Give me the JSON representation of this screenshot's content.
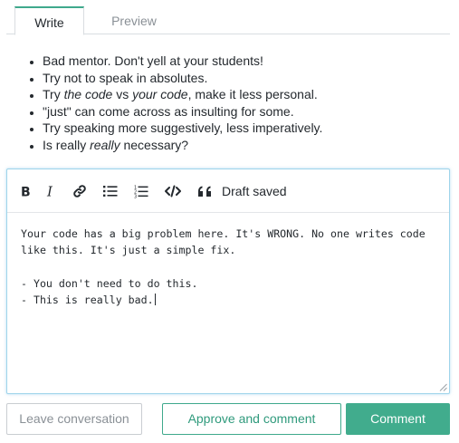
{
  "tabs": {
    "write_label": "Write",
    "preview_label": "Preview",
    "active": "Write"
  },
  "guidelines": [
    {
      "parts": [
        {
          "text": "Bad mentor. Don't yell at your students!",
          "em": false
        }
      ]
    },
    {
      "parts": [
        {
          "text": "Try not to speak in absolutes.",
          "em": false
        }
      ]
    },
    {
      "parts": [
        {
          "text": "Try ",
          "em": false
        },
        {
          "text": "the code",
          "em": true
        },
        {
          "text": " vs ",
          "em": false
        },
        {
          "text": "your code",
          "em": true
        },
        {
          "text": ", make it less personal.",
          "em": false
        }
      ]
    },
    {
      "parts": [
        {
          "text": "\"just\" can come across as insulting for some.",
          "em": false
        }
      ]
    },
    {
      "parts": [
        {
          "text": "Try speaking more suggestively, less imperatively.",
          "em": false
        }
      ]
    },
    {
      "parts": [
        {
          "text": "Is really ",
          "em": false
        },
        {
          "text": "really",
          "em": true
        },
        {
          "text": " necessary?",
          "em": false
        }
      ]
    }
  ],
  "toolbar": {
    "icons": [
      "bold-icon",
      "italic-icon",
      "link-icon",
      "bulleted-list-icon",
      "numbered-list-icon",
      "code-icon",
      "quote-icon"
    ],
    "status": "Draft saved"
  },
  "editor": {
    "lines": [
      "Your code has a big problem here. It's WRONG. No one writes code",
      "like this. It's just a simple fix.",
      "",
      "- You don't need to do this.",
      "- This is really bad."
    ]
  },
  "actions": {
    "leave_label": "Leave conversation",
    "approve_label": "Approve and comment",
    "comment_label": "Comment"
  },
  "colors": {
    "accent": "#41ac8d",
    "editor_focus_border": "#9fd4ea",
    "muted_text": "#8a9096"
  }
}
